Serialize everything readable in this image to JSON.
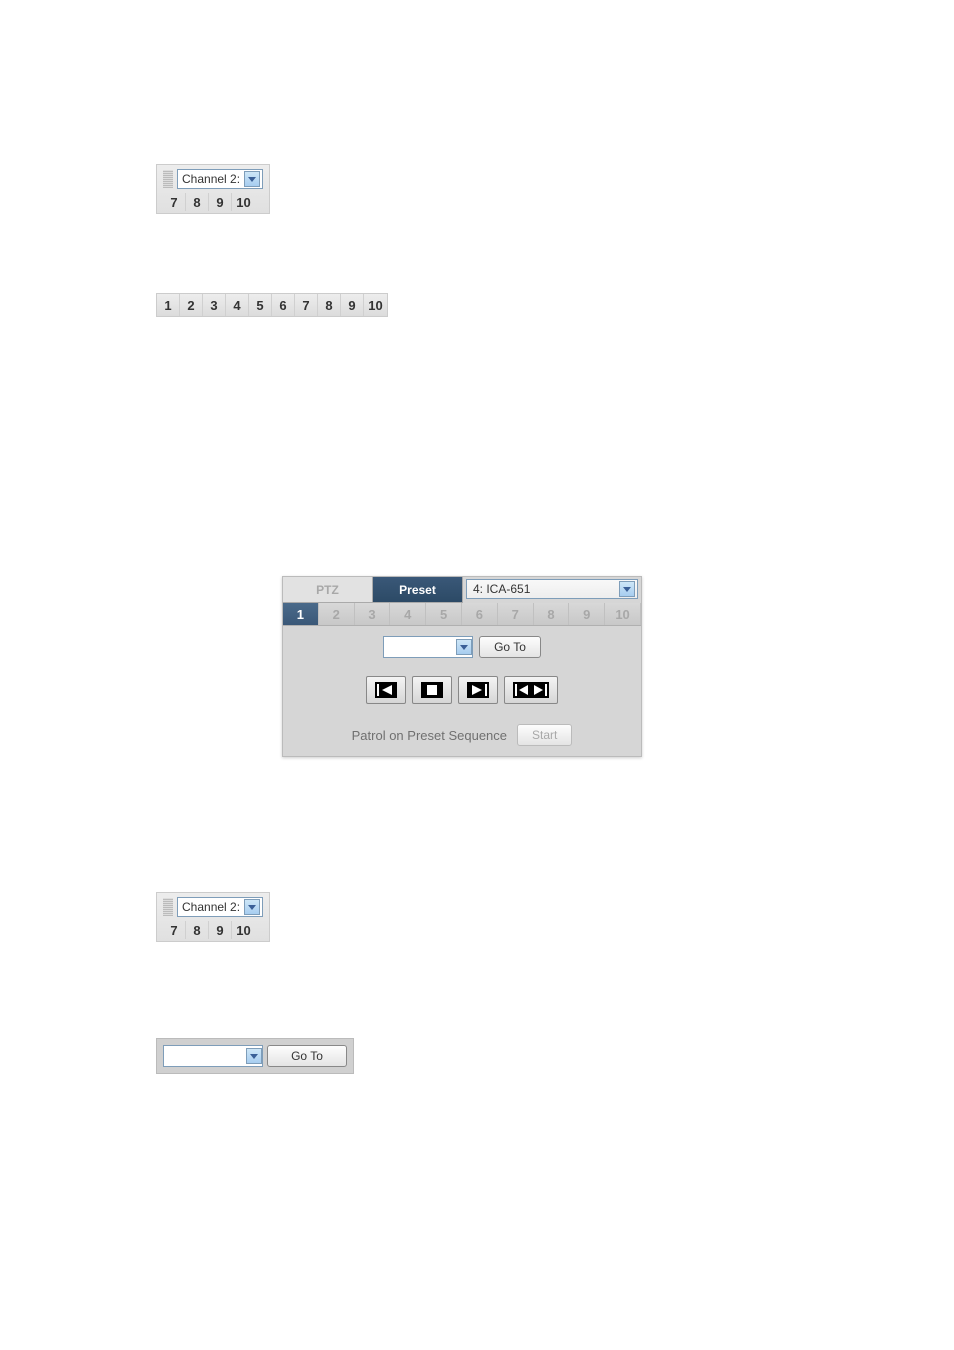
{
  "channel_widget_1": {
    "label": "Channel 2:",
    "nums": [
      "7",
      "8",
      "9",
      "10"
    ]
  },
  "num_strip": {
    "nums": [
      "1",
      "2",
      "3",
      "4",
      "5",
      "6",
      "7",
      "8",
      "9",
      "10"
    ]
  },
  "preset_panel": {
    "tab_ptz": "PTZ",
    "tab_preset": "Preset",
    "camera_selected": "4: ICA-651",
    "preset_nums": [
      "1",
      "2",
      "3",
      "4",
      "5",
      "6",
      "7",
      "8",
      "9",
      "10"
    ],
    "preset_active": "1",
    "goto_label": "Go To",
    "patrol_label": "Patrol on Preset Sequence",
    "start_label": "Start"
  },
  "channel_widget_2": {
    "label": "Channel 2:",
    "nums": [
      "7",
      "8",
      "9",
      "10"
    ]
  },
  "goto_widget": {
    "goto_label": "Go To"
  }
}
